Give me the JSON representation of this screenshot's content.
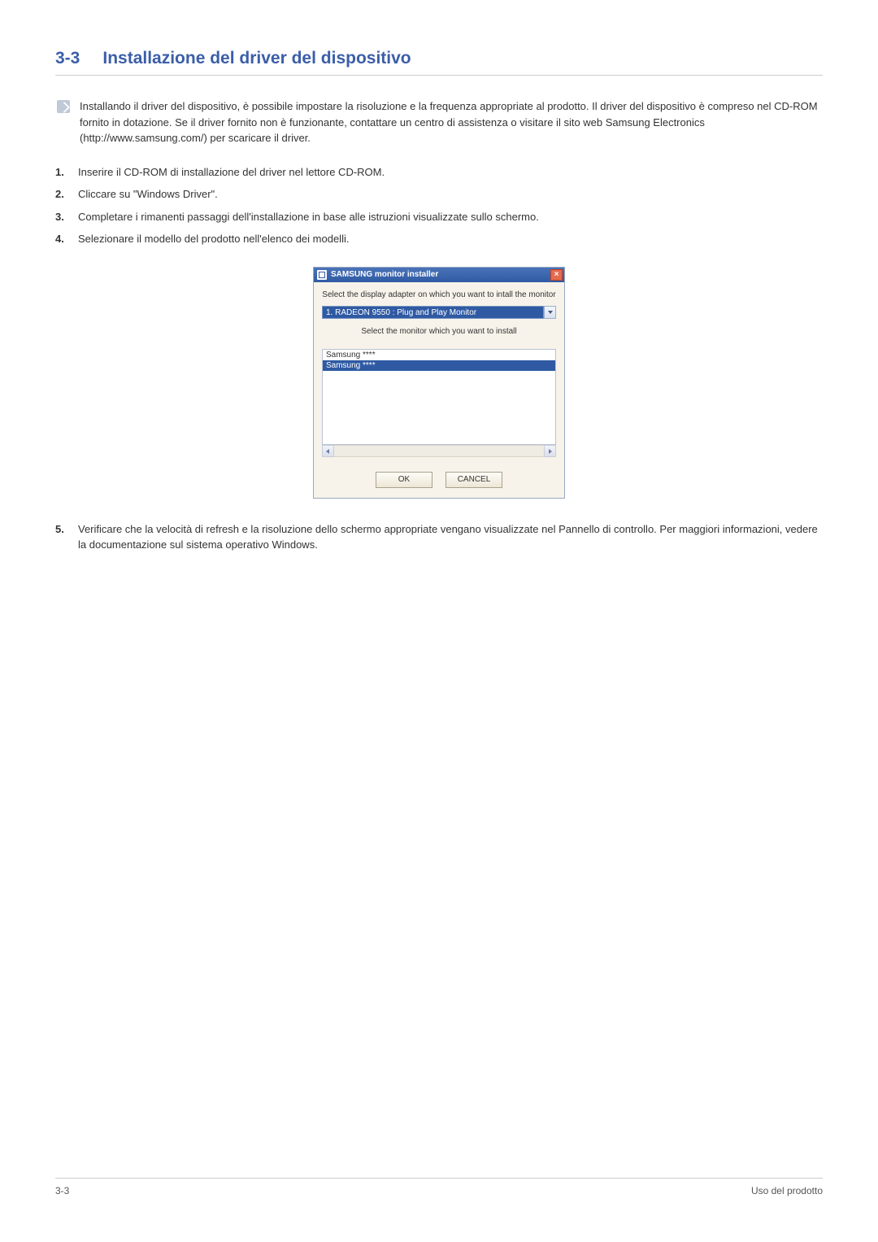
{
  "heading": {
    "num": "3-3",
    "title": "Installazione del driver del dispositivo"
  },
  "note": "Installando il driver del dispositivo, è possibile impostare la risoluzione e la frequenza appropriate al prodotto. Il driver del dispositivo è compreso nel CD-ROM fornito in dotazione. Se il driver fornito non è funzionante, contattare un centro di assistenza o visitare il sito web Samsung Electronics (http://www.samsung.com/) per scaricare il driver.",
  "steps_a": [
    "Inserire il CD-ROM di installazione del driver nel lettore CD-ROM.",
    "Cliccare su \"Windows Driver\".",
    "Completare i rimanenti passaggi dell'installazione in base alle istruzioni visualizzate sullo schermo.",
    "Selezionare il modello del prodotto nell'elenco dei modelli."
  ],
  "installer": {
    "title": "SAMSUNG monitor installer",
    "instruction_top": "Select the display adapter on which you want to intall the monitor",
    "adapter_value": "1. RADEON 9550 : Plug and Play Monitor",
    "instruction_mid": "Select the monitor which you want to install",
    "monitors": [
      "Samsung ****",
      "Samsung ****"
    ],
    "ok_label": "OK",
    "cancel_label": "CANCEL"
  },
  "steps_b": [
    "Verificare che la velocità di refresh e la risoluzione dello schermo appropriate vengano visualizzate nel Pannello di controllo. Per maggiori informazioni, vedere la documentazione sul sistema operativo Windows."
  ],
  "footer": {
    "left": "3-3",
    "right": "Uso del prodotto"
  }
}
